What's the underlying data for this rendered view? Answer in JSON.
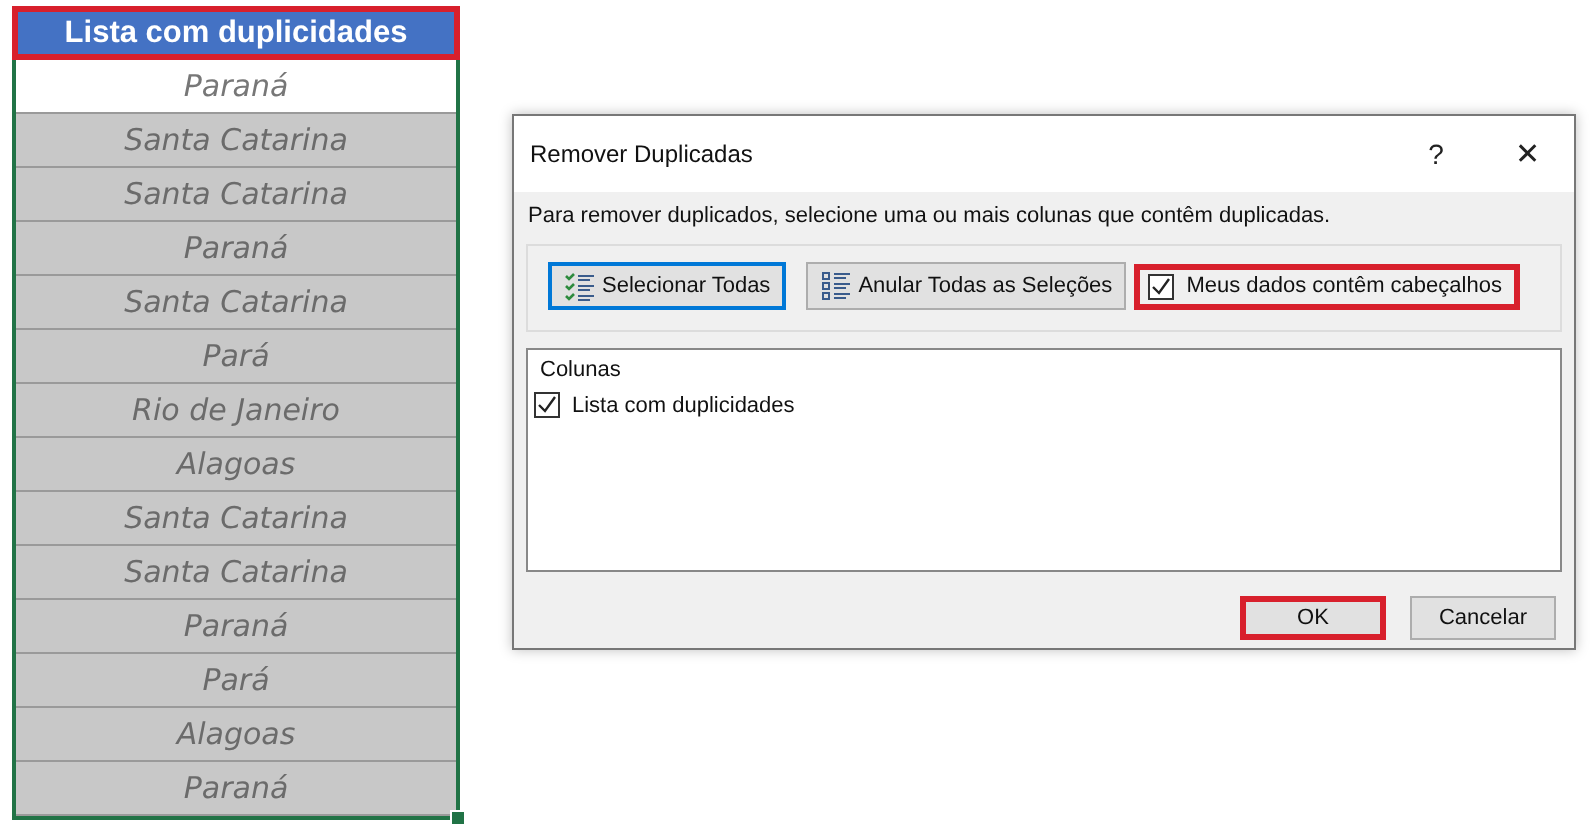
{
  "sheet": {
    "header": {
      "text": "Lista com duplicidades",
      "annotated": true
    },
    "rows": [
      {
        "text": "Paraná",
        "highlighted": false
      },
      {
        "text": "Santa Catarina",
        "highlighted": true
      },
      {
        "text": "Santa Catarina",
        "highlighted": true
      },
      {
        "text": "Paraná",
        "highlighted": true
      },
      {
        "text": "Santa Catarina",
        "highlighted": true
      },
      {
        "text": "Pará",
        "highlighted": true
      },
      {
        "text": "Rio de Janeiro",
        "highlighted": true
      },
      {
        "text": "Alagoas",
        "highlighted": true
      },
      {
        "text": "Santa Catarina",
        "highlighted": true
      },
      {
        "text": "Santa Catarina",
        "highlighted": true
      },
      {
        "text": "Paraná",
        "highlighted": true
      },
      {
        "text": "Pará",
        "highlighted": true
      },
      {
        "text": "Alagoas",
        "highlighted": true
      },
      {
        "text": "Paraná",
        "highlighted": true
      }
    ]
  },
  "dialog": {
    "title": "Remover Duplicadas",
    "help": "?",
    "close": "✕",
    "description": "Para remover duplicados, selecione uma ou mais colunas que contêm duplicadas.",
    "buttons": [
      {
        "label": "Selecionar Todas",
        "kind": "select-all",
        "focused": true
      },
      {
        "label": "Anular Todas as Seleções",
        "kind": "unselect-all",
        "focused": false
      }
    ],
    "headers_checkbox": {
      "label": "Meus dados contêm cabeçalhos",
      "checked": true,
      "annotated": true
    },
    "columns": {
      "title": "Colunas",
      "items": [
        {
          "label": "Lista com duplicidades",
          "checked": true
        }
      ]
    },
    "actions": [
      {
        "label": "OK",
        "annotated": true
      },
      {
        "label": "Cancelar",
        "annotated": false
      }
    ]
  }
}
